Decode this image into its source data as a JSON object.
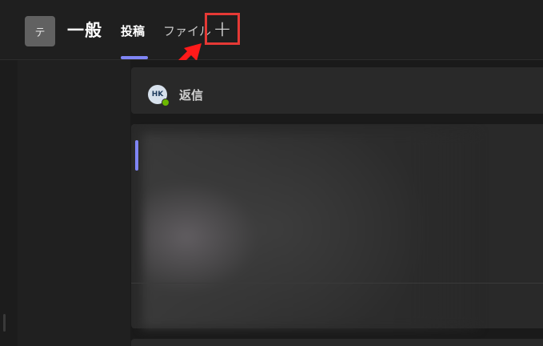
{
  "header": {
    "team_avatar_initial": "テ",
    "channel_name": "一般",
    "tabs": [
      {
        "label": "投稿",
        "active": true
      },
      {
        "label": "ファイル",
        "active": false
      }
    ],
    "add_tab_symbol": "+"
  },
  "thread": {
    "reply_avatar_initials": "HK",
    "reply_label": "返信"
  },
  "colors": {
    "accent": "#7f85f5",
    "highlight_box": "#e53935",
    "presence_available": "#6bb700"
  },
  "icons": {
    "annotation": "red-arrow-icon",
    "add": "plus-icon"
  }
}
